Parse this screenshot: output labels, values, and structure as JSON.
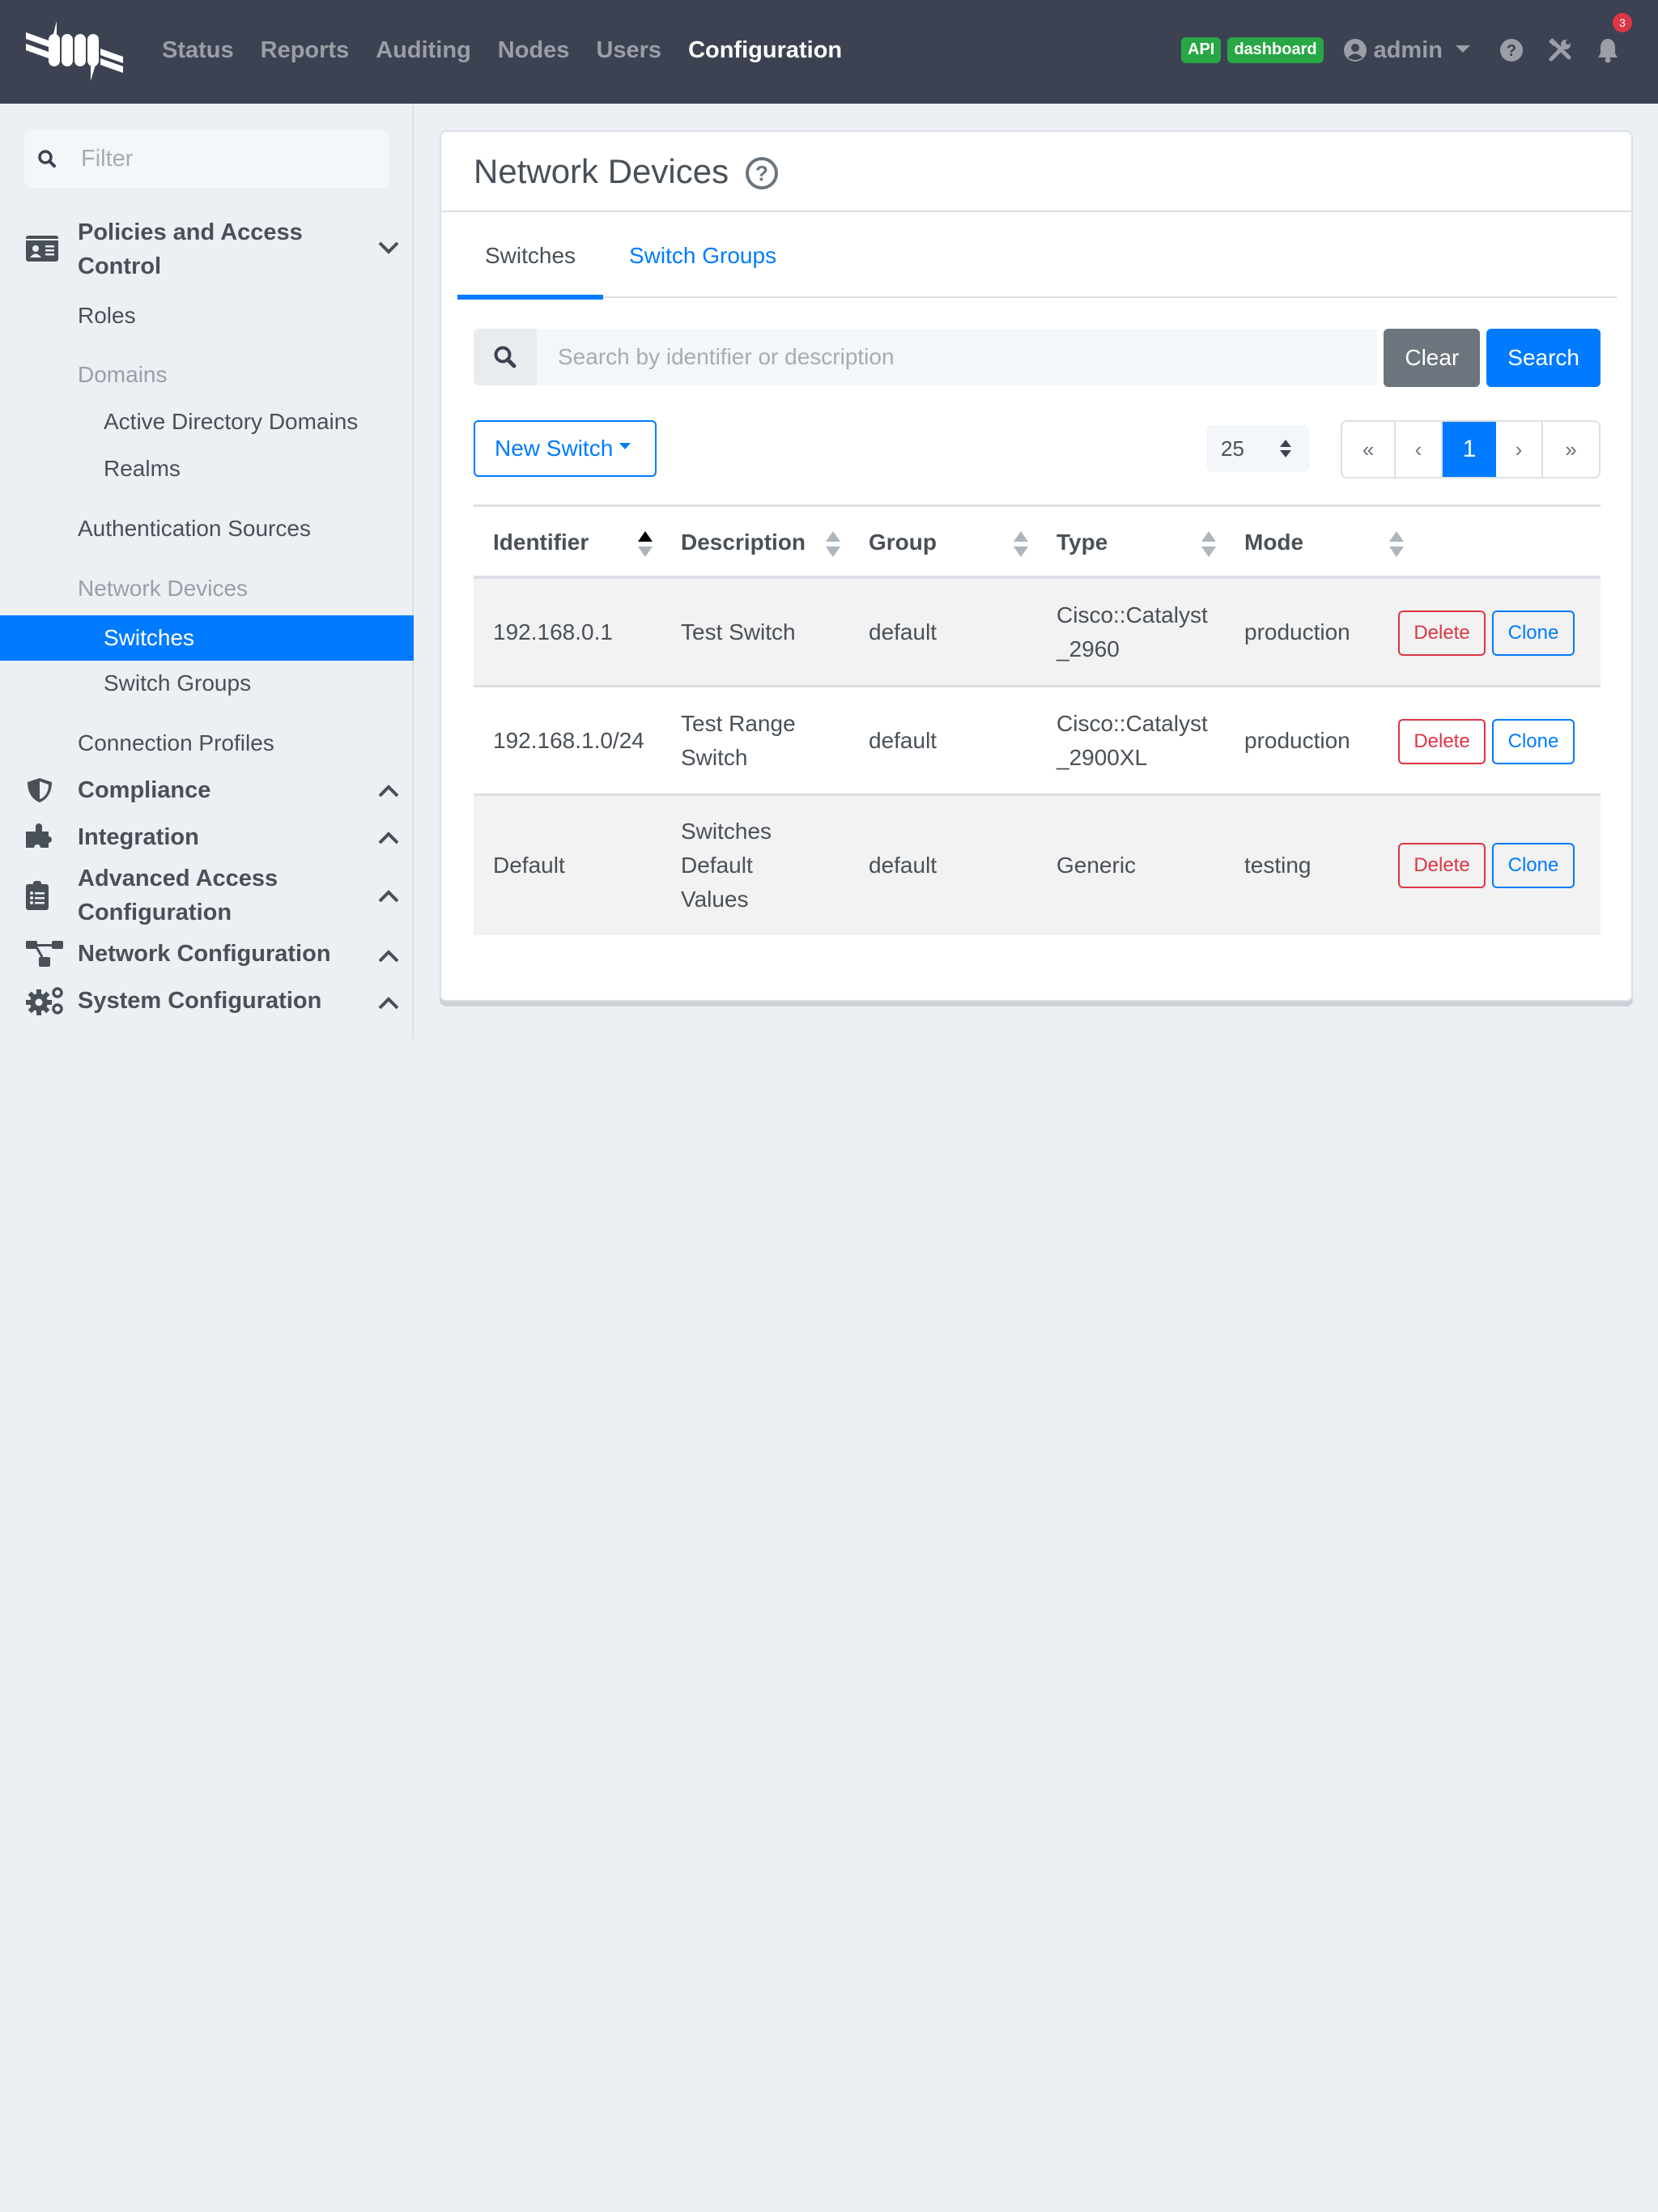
{
  "navbar": {
    "links": [
      "Status",
      "Reports",
      "Auditing",
      "Nodes",
      "Users",
      "Configuration"
    ],
    "active_link": "Configuration",
    "badges": [
      "API",
      "dashboard"
    ],
    "user": "admin",
    "notification_count": "3",
    "icons": [
      "logo-icon",
      "user-circle-icon",
      "help-icon",
      "tools-icon",
      "bell-icon"
    ]
  },
  "sidebar": {
    "filter_placeholder": "Filter",
    "sections": [
      {
        "title": "Policies and Access Control",
        "icon": "id-card-icon",
        "expanded": true
      },
      {
        "title": "Compliance",
        "icon": "shield-icon",
        "expanded": false
      },
      {
        "title": "Integration",
        "icon": "puzzle-icon",
        "expanded": false
      },
      {
        "title": "Advanced Access Configuration",
        "icon": "clipboard-list-icon",
        "expanded": false
      },
      {
        "title": "Network Configuration",
        "icon": "network-icon",
        "expanded": false
      },
      {
        "title": "System Configuration",
        "icon": "cogs-icon",
        "expanded": false
      }
    ],
    "items": [
      {
        "label": "Roles"
      },
      {
        "label": "Domains",
        "group": true
      },
      {
        "label": "Active Directory Domains"
      },
      {
        "label": "Realms"
      },
      {
        "label": "Authentication Sources"
      },
      {
        "label": "Network Devices",
        "group": true
      },
      {
        "label": "Switches",
        "active": true
      },
      {
        "label": "Switch Groups"
      },
      {
        "label": "Connection Profiles"
      }
    ]
  },
  "main": {
    "title": "Network Devices",
    "tabs": [
      {
        "label": "Switches",
        "active": true
      },
      {
        "label": "Switch Groups",
        "active": false
      }
    ],
    "search": {
      "placeholder": "Search by identifier or description",
      "value": "",
      "clear_label": "Clear",
      "search_label": "Search"
    },
    "new_button_label": "New Switch",
    "per_page": "25",
    "pagination": [
      "«",
      "‹",
      "1",
      "›",
      "»"
    ],
    "current_page": "1",
    "table": {
      "columns": [
        "Identifier",
        "Description",
        "Group",
        "Type",
        "Mode"
      ],
      "sorted_column": "Identifier",
      "sort_direction": "ascending",
      "rows": [
        {
          "identifier": "192.168.0.1",
          "description": "Test Switch",
          "group": "default",
          "type": "Cisco::Catalyst_2960",
          "mode": "production"
        },
        {
          "identifier": "192.168.1.0/24",
          "description": "Test Range Switch",
          "group": "default",
          "type": "Cisco::Catalyst_2900XL",
          "mode": "production"
        },
        {
          "identifier": "Default",
          "description": "Switches Default Values",
          "group": "default",
          "type": "Generic",
          "mode": "testing"
        }
      ],
      "row_actions": {
        "delete_label": "Delete",
        "clone_label": "Clone"
      }
    }
  },
  "colors": {
    "navbar_bg": "#3c4252",
    "primary": "#007bff",
    "success": "#28a745",
    "danger": "#dc3545",
    "secondary": "#6c757d",
    "page_bg": "#eceff4"
  }
}
